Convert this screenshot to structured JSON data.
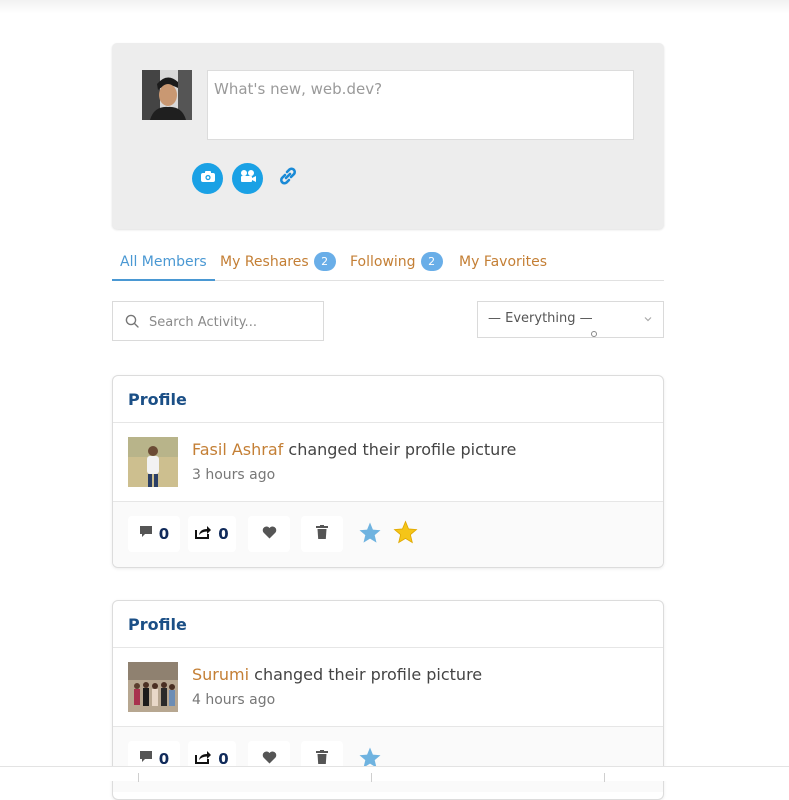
{
  "composer": {
    "placeholder": "What's new, web.dev?",
    "tools": [
      "camera-icon",
      "video-icon",
      "link-icon"
    ]
  },
  "tabs": [
    {
      "label": "All Members",
      "count": null,
      "active": true
    },
    {
      "label": "My Reshares",
      "count": "2",
      "active": false
    },
    {
      "label": "Following",
      "count": "2",
      "active": false
    },
    {
      "label": "My Favorites",
      "count": null,
      "active": false
    }
  ],
  "search": {
    "placeholder": "Search Activity..."
  },
  "filter": {
    "selected": "— Everything —"
  },
  "activities": [
    {
      "type_label": "Profile",
      "user": "Fasil Ashraf",
      "action": "changed their profile picture",
      "time": "3 hours ago",
      "comments": "0",
      "reshares": "0"
    },
    {
      "type_label": "Profile",
      "user": "Surumi",
      "action": "changed their profile picture",
      "time": "4 hours ago",
      "comments": "0",
      "reshares": "0"
    }
  ],
  "colors": {
    "accent_blue": "#1aa1e5",
    "tab_active": "#4a98d3",
    "link_orange": "#c47f35",
    "card_title": "#1b4f86",
    "star_blue": "#6fb3e0",
    "star_gold": "#f5c518"
  }
}
